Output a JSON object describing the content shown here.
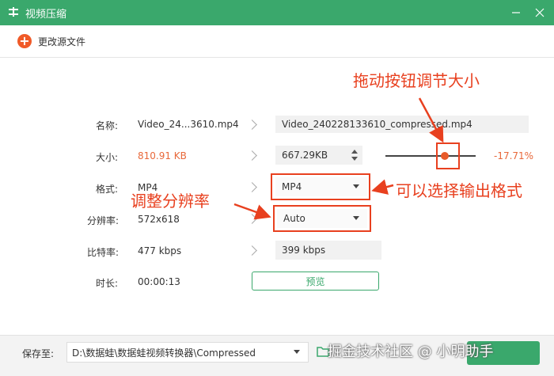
{
  "window": {
    "title": "视频压缩"
  },
  "toolbar": {
    "add_label": "更改源文件"
  },
  "rows": {
    "name_label": "名称:",
    "name_value": "Video_24...3610.mp4",
    "output_name": "Video_240228133610_compressed.mp4",
    "size_label": "大小:",
    "size_value": "810.91 KB",
    "target_size": "667.29KB",
    "size_percent": "-17.71%",
    "format_label": "格式:",
    "format_value": "MP4",
    "format_select": "MP4",
    "res_label": "分辨率:",
    "res_value": "572x618",
    "res_select": "Auto",
    "bitrate_label": "比特率:",
    "bitrate_value": "477 kbps",
    "target_bitrate": "399 kbps",
    "duration_label": "时长:",
    "duration_value": "00:00:13",
    "preview_label": "预览"
  },
  "slider": {
    "value_fraction": 0.66
  },
  "annotations": {
    "drag": "拖动按钮调节大小",
    "format": "可以选择输出格式",
    "resolution": "调整分辨率"
  },
  "bottom": {
    "save_label": "保存至:",
    "save_path": "D:\\数据蛙\\数据蛙视频转换器\\Compressed"
  },
  "watermark": {
    "text": "掘金技术社区 @ 小明助手"
  },
  "colors": {
    "brand": "#3aa86c",
    "accent": "#e8401f",
    "size_orange": "#e8683a"
  }
}
